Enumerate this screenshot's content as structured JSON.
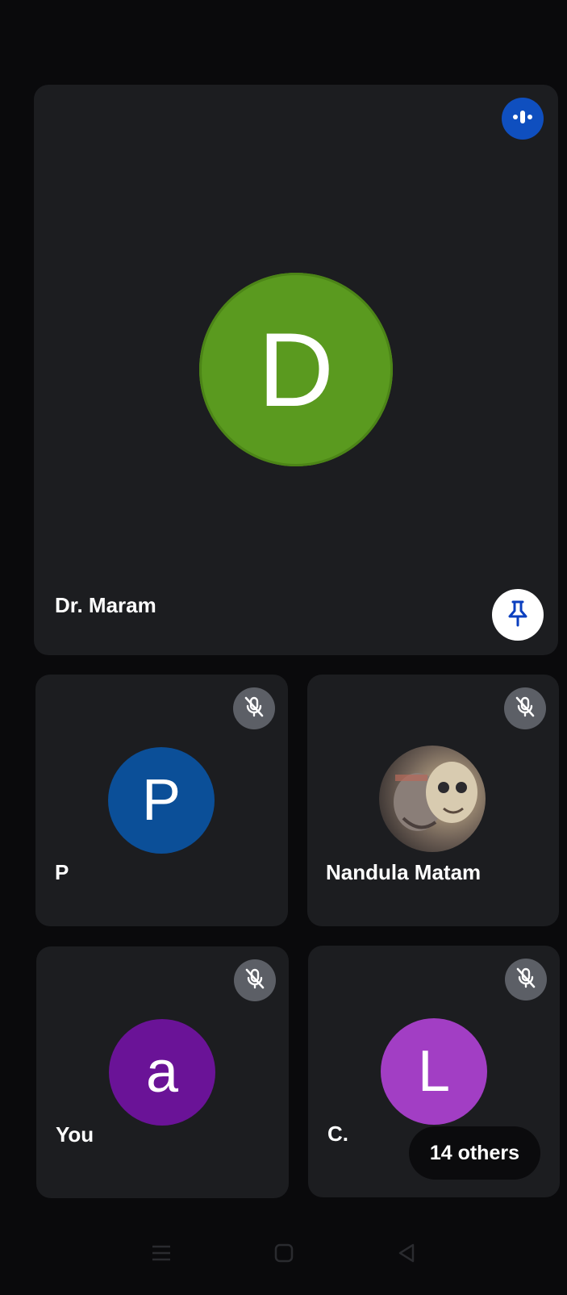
{
  "main_tile": {
    "participant_name": "Dr. Maram",
    "avatar_letter": "D",
    "avatar_color": "#5a9a1f",
    "speaking_icon": "audio-wave-icon",
    "pin_icon": "pin-icon"
  },
  "tiles": [
    {
      "participant_name": "P",
      "avatar_letter": "P",
      "avatar_color": "#0b4f98",
      "mute_icon": "mic-off-icon"
    },
    {
      "participant_name": "Nandula Matam",
      "avatar_type": "photo",
      "mute_icon": "mic-off-icon"
    },
    {
      "participant_name": "You",
      "avatar_letter": "a",
      "avatar_color": "#6a1397",
      "mute_icon": "mic-off-icon"
    },
    {
      "participant_name": "C.",
      "avatar_letter": "L",
      "avatar_color": "#a23ec4",
      "mute_icon": "mic-off-icon",
      "others_label": "14 others"
    }
  ],
  "nav_bar": {
    "icons": [
      "menu-icon",
      "home-icon",
      "back-icon"
    ]
  }
}
